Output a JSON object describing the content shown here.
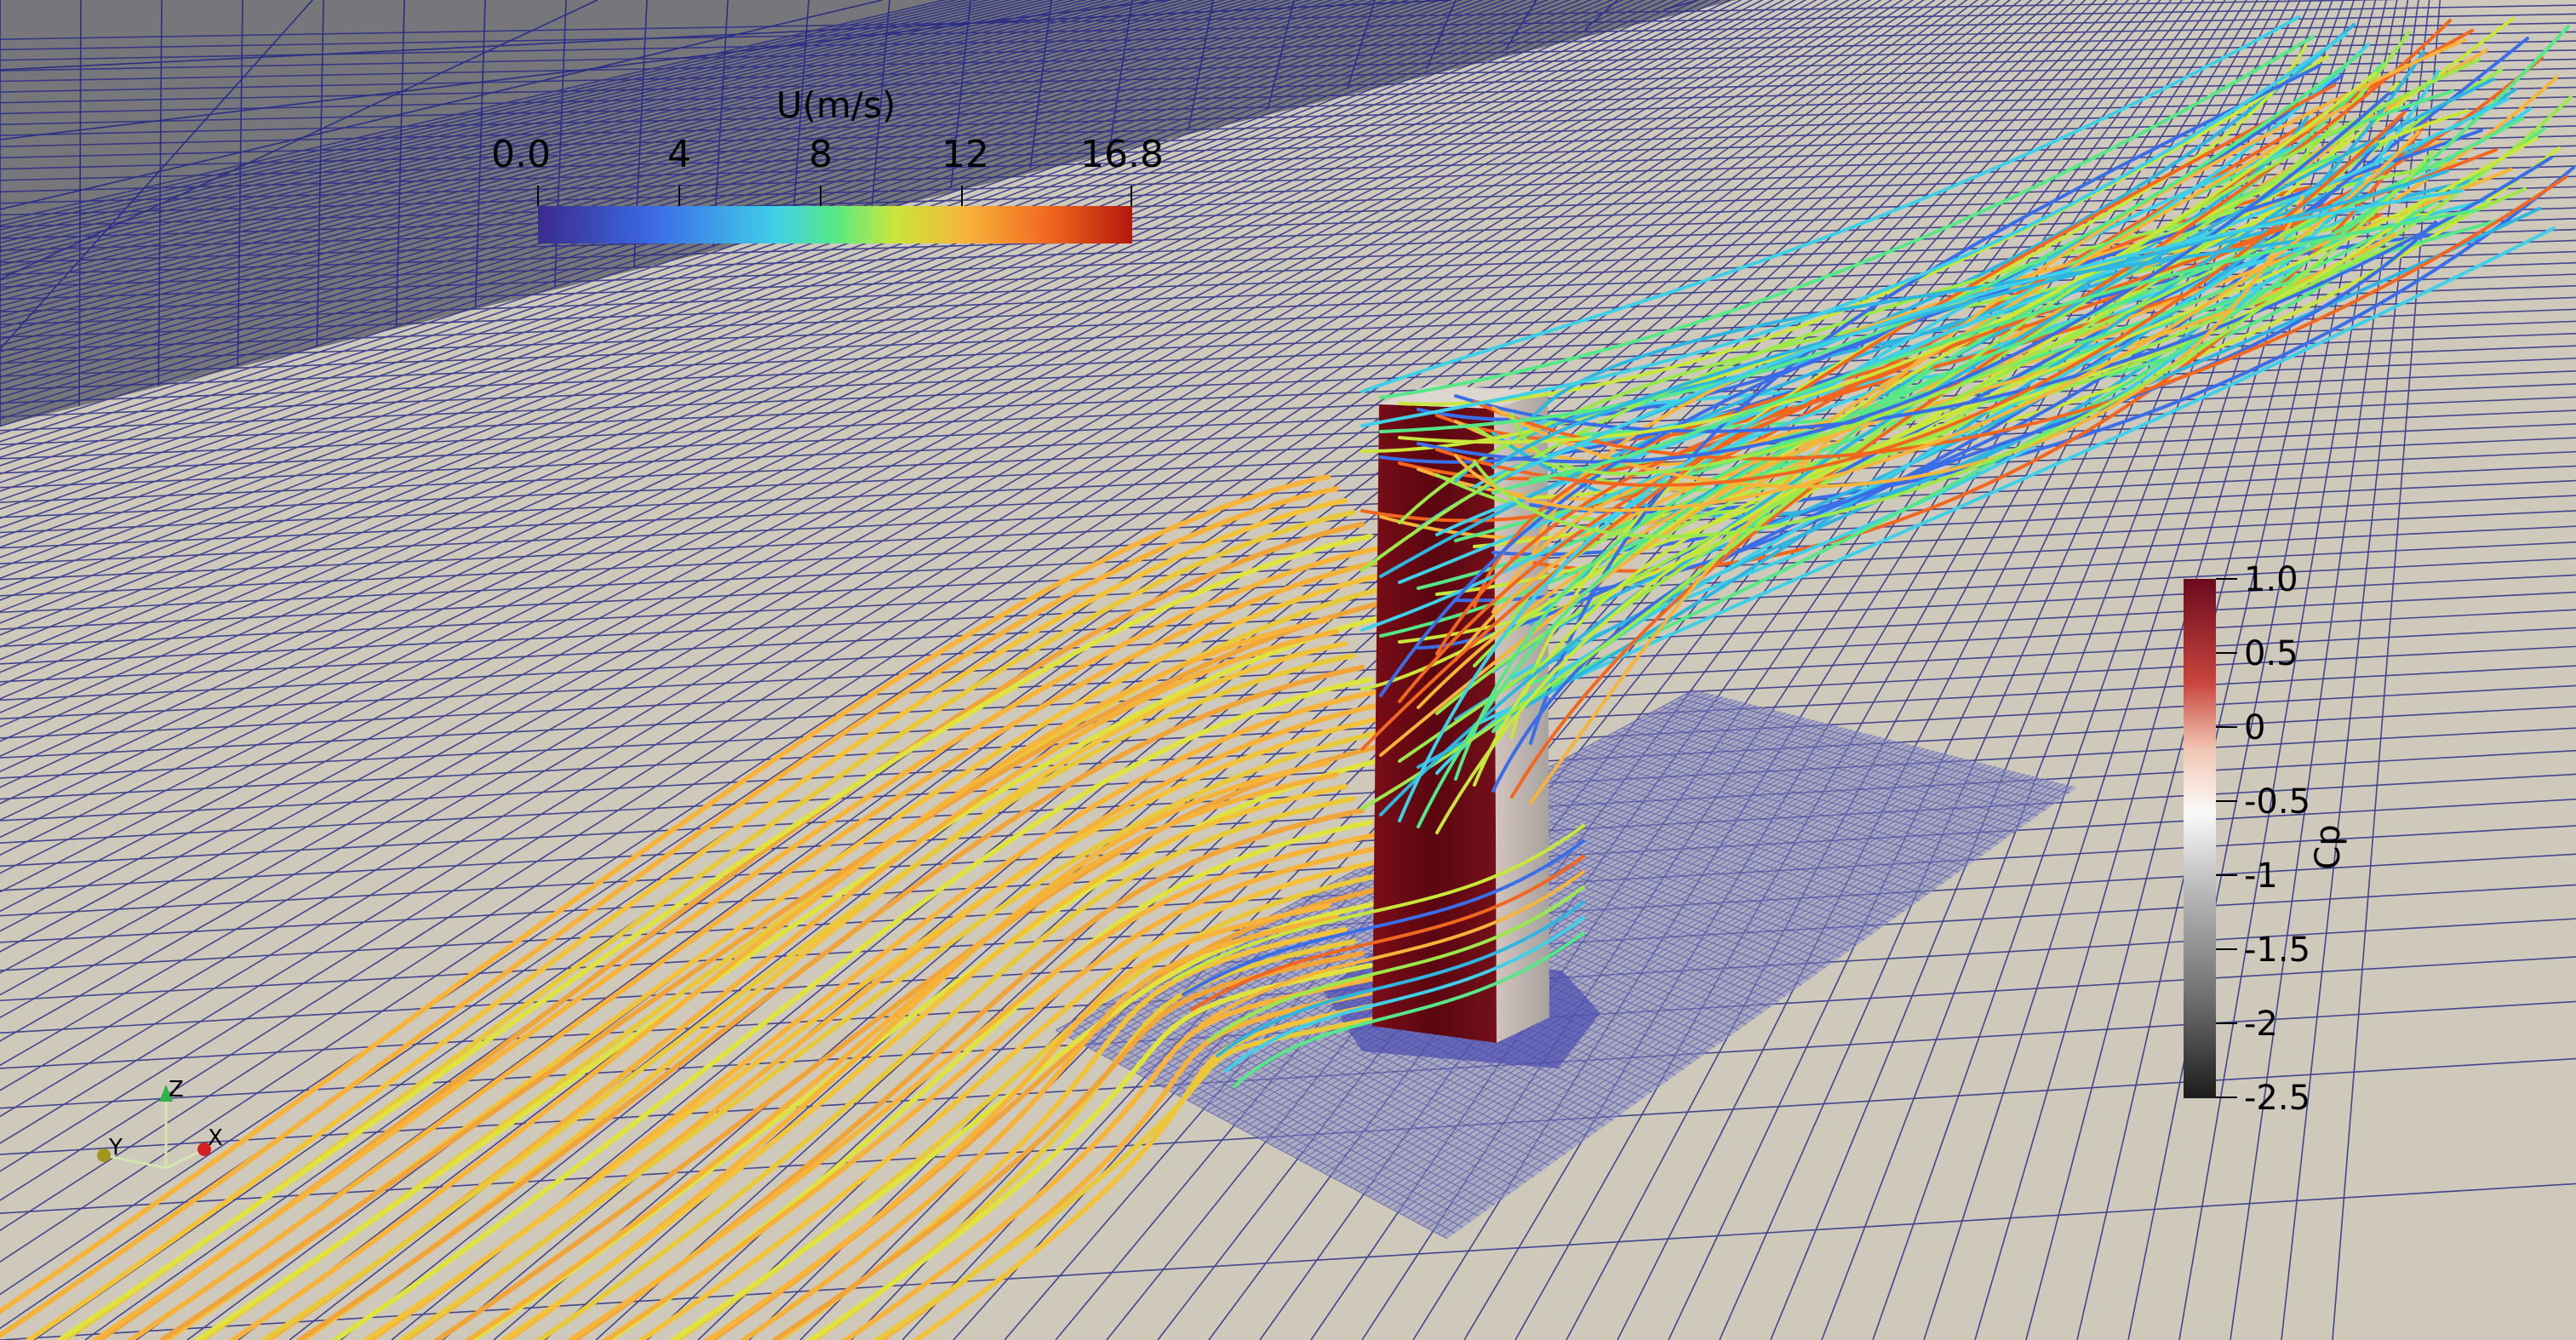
{
  "velocity_legend": {
    "title": "U(m/s)",
    "ticks": [
      "0.0",
      "4",
      "8",
      "12",
      "16.8"
    ],
    "colors": [
      "#3b2b8c",
      "#3a6de8",
      "#3fd0e8",
      "#56e887",
      "#c9e63a",
      "#f6b43a",
      "#f2671f",
      "#b3180c"
    ]
  },
  "cp_legend": {
    "title": "Cp",
    "ticks": [
      "1.0",
      "0.5",
      "0",
      "-0.5",
      "-1",
      "-1.5",
      "-2",
      "-2.5"
    ],
    "colors": [
      "#6b0a1d",
      "#c8453e",
      "#f3c7b4",
      "#fafafa",
      "#b9b9b9",
      "#6a6a6a",
      "#1c1c1c"
    ]
  },
  "axes_triad": {
    "z": "Z",
    "y": "Y",
    "x": "X"
  },
  "colors": {
    "ground": "#cfc9bc",
    "wall": "#77777b",
    "mesh_line": "#2a2d86",
    "refined_region": "#8e90c8",
    "building_windward": "#6a0913",
    "building_side": "#b7b2ac",
    "building_top": "#ddd6ce"
  }
}
